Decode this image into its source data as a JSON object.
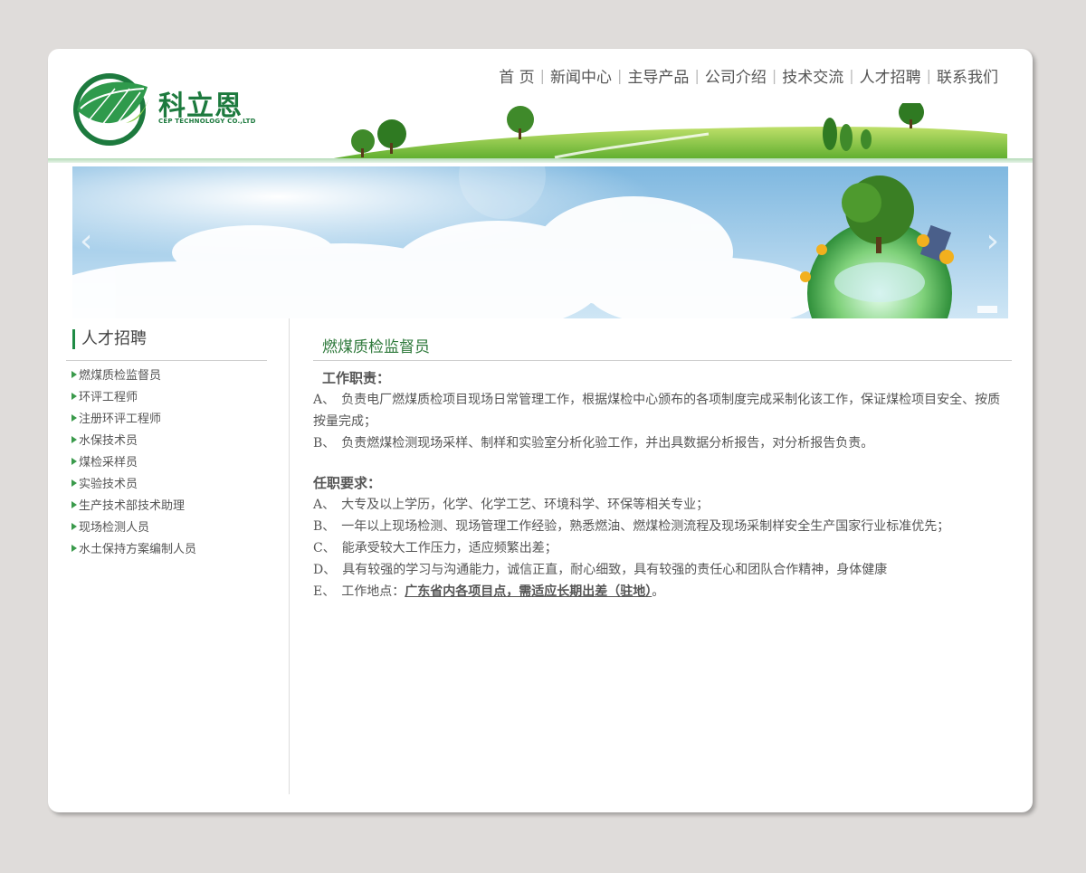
{
  "logo": {
    "name_cn": "科立恩",
    "name_en": "CEP TECHNOLOGY CO.,LTD"
  },
  "nav": {
    "items": [
      "首 页",
      "新闻中心",
      "主导产品",
      "公司介绍",
      "技术交流",
      "人才招聘",
      "联系我们"
    ]
  },
  "banner": {
    "prev_icon": "chevron-left-icon",
    "next_icon": "chevron-right-icon"
  },
  "sidebar": {
    "title": "人才招聘",
    "items": [
      "燃煤质检监督员",
      "环评工程师",
      "注册环评工程师",
      "水保技术员",
      "煤检采样员",
      "实验技术员",
      "生产技术部技术助理",
      "现场检测人员",
      "水土保持方案编制人员"
    ]
  },
  "content": {
    "title": "燃煤质检监督员",
    "duties_heading": "工作职责：",
    "duties": [
      "A、　负责电厂燃煤质检项目现场日常管理工作，根据煤检中心颁布的各项制度完成采制化该工作，保证煤检项目安全、按质按量完成；",
      "B、　负责燃煤检测现场采样、制样和实验室分析化验工作，并出具数据分析报告，对分析报告负责。"
    ],
    "requirements_heading": "任职要求：",
    "requirements": [
      "A、　大专及以上学历，化学、化学工艺、环境科学、环保等相关专业；",
      "B、　一年以上现场检测、现场管理工作经验，熟悉燃油、燃煤检测流程及现场采制样安全生产国家行业标准优先；",
      "C、　能承受较大工作压力，适应频繁出差；",
      "D、　具有较强的学习与沟通能力，诚信正直，耐心细致，具有较强的责任心和团队合作精神，身体健康"
    ],
    "location_prefix": "E、　工作地点：",
    "location": "广东省内各项目点，需适应长期出差（驻地）",
    "location_suffix": "。"
  },
  "colors": {
    "brand_green": "#1d7a3e",
    "page_bg": "#dfdcda"
  }
}
